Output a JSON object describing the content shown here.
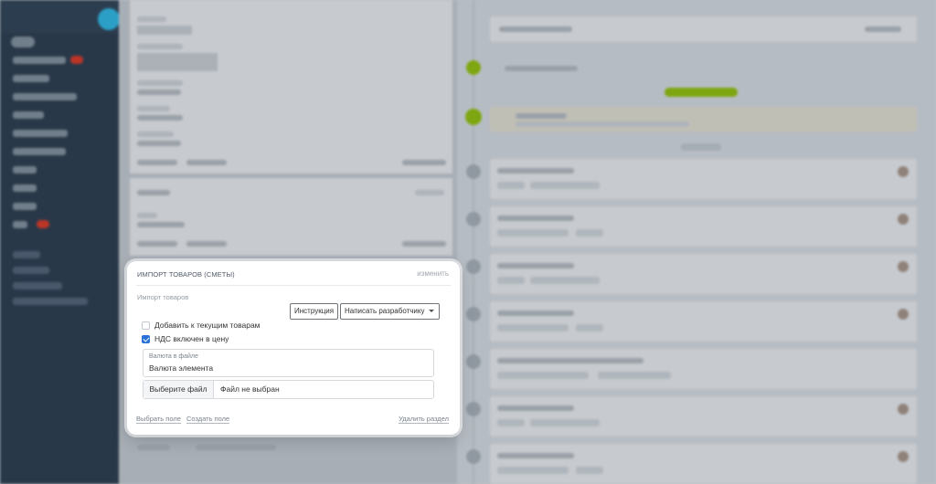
{
  "import_section": {
    "title": "ИМПОРТ ТОВАРОВ (СМЕТЫ)",
    "edit_link": "изменить",
    "field_label": "Импорт товаров",
    "instruction_button": "Инструкция",
    "write_developer_button": "Написать разработчику",
    "add_to_current_label": "Добавить к текущим товарам",
    "add_to_current_checked": false,
    "vat_included_label": "НДС включен в цену",
    "vat_included_checked": true,
    "currency_field": {
      "label": "Валюта в файле",
      "value": "Валюта элемента"
    },
    "file_picker": {
      "button": "Выберите файл",
      "status": "Файл не выбран"
    },
    "footer": {
      "select_field": "Выбрать поле",
      "create_field": "Создать поле",
      "delete_section": "Удалить раздел"
    }
  },
  "colors": {
    "checkbox_accent": "#2b72d8",
    "sidebar_bg": "#2a3b4c",
    "timeline_green": "#9dcf00"
  }
}
